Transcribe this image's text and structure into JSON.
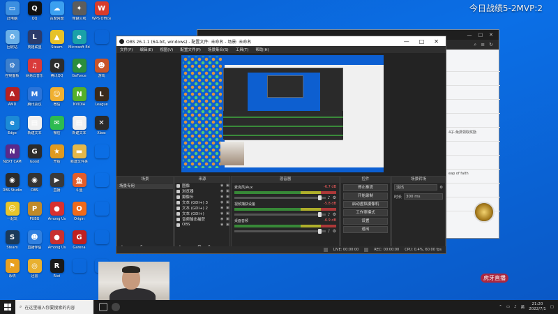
{
  "overlay": {
    "title": "今日战绩5-2MVP:2"
  },
  "desktop": {
    "icons": [
      {
        "label": "此电脑",
        "icon": "computer-icon",
        "color": "#3c8fe0",
        "glyph": "▭"
      },
      {
        "label": "QQ",
        "icon": "qq-icon",
        "color": "#111111",
        "glyph": "Q"
      },
      {
        "label": "百度网盘",
        "icon": "baidu-netdisk-icon",
        "color": "#3ca0f0",
        "glyph": "☁"
      },
      {
        "label": "穿越火线",
        "icon": "game-icon",
        "color": "#5d5d5d",
        "glyph": "✦"
      },
      {
        "label": "WPS Office",
        "icon": "wps-icon",
        "color": "#d83b2b",
        "glyph": "W"
      },
      {
        "label": "回收站",
        "icon": "recycle-bin-icon",
        "color": "#6ab0e8",
        "glyph": "♻"
      },
      {
        "label": "英雄联盟",
        "icon": "game-icon",
        "color": "#2b3b6b",
        "glyph": "L"
      },
      {
        "label": "Steam",
        "icon": "app-icon",
        "color": "#e6c229",
        "glyph": "▲"
      },
      {
        "label": "Microsoft Edge",
        "icon": "edge-icon",
        "color": "#1aa1a8",
        "glyph": "e"
      },
      {
        "label": "",
        "icon": "blank-icon",
        "color": "transparent",
        "glyph": ""
      },
      {
        "label": "控制面板",
        "icon": "control-panel-icon",
        "color": "#3d7fcc",
        "glyph": "⚙"
      },
      {
        "label": "网易云音乐",
        "icon": "music-icon",
        "color": "#d93a3a",
        "glyph": "♫"
      },
      {
        "label": "腾讯QQ",
        "icon": "qq-icon",
        "color": "#2d2d2d",
        "glyph": "Q"
      },
      {
        "label": "GeForce",
        "icon": "geforce-icon",
        "color": "#2c8e3c",
        "glyph": "◆"
      },
      {
        "label": "游戏",
        "icon": "game-icon",
        "color": "#c8542a",
        "glyph": "☻"
      },
      {
        "label": "AMD",
        "icon": "amd-icon",
        "color": "#b62121",
        "glyph": "A"
      },
      {
        "label": "腾讯会议",
        "icon": "meeting-icon",
        "color": "#2b74d9",
        "glyph": "M"
      },
      {
        "label": "微信",
        "icon": "app-icon",
        "color": "#f0b030",
        "glyph": "☺"
      },
      {
        "label": "NVIDIA",
        "icon": "nvidia-icon",
        "color": "#55b02a",
        "glyph": "N"
      },
      {
        "label": "League",
        "icon": "game-icon",
        "color": "#3a2a1a",
        "glyph": "L"
      },
      {
        "label": "Edge",
        "icon": "edge-icon",
        "color": "#1c8ad6",
        "glyph": "e"
      },
      {
        "label": "新建文本",
        "icon": "file-icon",
        "color": "#f0f0f0",
        "glyph": "▤"
      },
      {
        "label": "微信",
        "icon": "wechat-icon",
        "color": "#2dbb50",
        "glyph": "✉"
      },
      {
        "label": "新建文本",
        "icon": "file-icon",
        "color": "#f0f0f0",
        "glyph": "▤"
      },
      {
        "label": "Xbox",
        "icon": "xbox-icon",
        "color": "#2a2a2a",
        "glyph": "✕"
      },
      {
        "label": "NZXT CAM",
        "icon": "nzxt-icon",
        "color": "#5a2a8a",
        "glyph": "N"
      },
      {
        "label": "Good",
        "icon": "app-icon",
        "color": "#2b2b2b",
        "glyph": "G"
      },
      {
        "label": "开始",
        "icon": "app-icon",
        "color": "#e09a20",
        "glyph": "★"
      },
      {
        "label": "新建文件夹",
        "icon": "folder-icon",
        "color": "#e5b84a",
        "glyph": "▬"
      },
      {
        "label": "",
        "icon": "blank-icon",
        "color": "transparent",
        "glyph": ""
      },
      {
        "label": "OBS Studio",
        "icon": "obs-icon",
        "color": "#2b2b2b",
        "glyph": "◉"
      },
      {
        "label": "OBS",
        "icon": "obs-icon",
        "color": "#333333",
        "glyph": "◉"
      },
      {
        "label": "直播",
        "icon": "app-icon",
        "color": "#3a3a3a",
        "glyph": "▶"
      },
      {
        "label": "斗鱼",
        "icon": "app-icon",
        "color": "#e35d2a",
        "glyph": "鱼"
      },
      {
        "label": "",
        "icon": "blank-icon",
        "color": "transparent",
        "glyph": ""
      },
      {
        "label": "一起玩",
        "icon": "app-icon",
        "color": "#e8c52a",
        "glyph": "☺"
      },
      {
        "label": "PUBG",
        "icon": "pubg-icon",
        "color": "#c08a2a",
        "glyph": "P"
      },
      {
        "label": "Among Us",
        "icon": "app-icon",
        "color": "#d83030",
        "glyph": "●"
      },
      {
        "label": "Origin",
        "icon": "origin-icon",
        "color": "#f06a1a",
        "glyph": "O"
      },
      {
        "label": "",
        "icon": "blank-icon",
        "color": "transparent",
        "glyph": ""
      },
      {
        "label": "Steam",
        "icon": "steam-icon",
        "color": "#1b3a5a",
        "glyph": "S"
      },
      {
        "label": "直播伴侣",
        "icon": "app-icon",
        "color": "#3080e0",
        "glyph": "☻"
      },
      {
        "label": "Among Us",
        "icon": "app-icon",
        "color": "#c83030",
        "glyph": "●"
      },
      {
        "label": "Garena",
        "icon": "app-icon",
        "color": "#c02020",
        "glyph": "G"
      },
      {
        "label": "",
        "icon": "blank-icon",
        "color": "transparent",
        "glyph": ""
      },
      {
        "label": "系统",
        "icon": "app-icon",
        "color": "#e8a020",
        "glyph": "⚑"
      },
      {
        "label": "迅雷",
        "icon": "app-icon",
        "color": "#e8b030",
        "glyph": "◎"
      },
      {
        "label": "Riot",
        "icon": "riot-icon",
        "color": "#1a1a1a",
        "glyph": "R"
      },
      {
        "label": "",
        "icon": "blank-icon",
        "color": "transparent",
        "glyph": ""
      },
      {
        "label": "",
        "icon": "blank-icon",
        "color": "transparent",
        "glyph": ""
      }
    ]
  },
  "side_window": {
    "controls": [
      "—",
      "□",
      "✕"
    ],
    "items": [
      {
        "title": "",
        "sub": ""
      },
      {
        "title": "",
        "sub": ""
      },
      {
        "title": "",
        "sub": ""
      },
      {
        "title": "",
        "sub": ""
      },
      {
        "title": "",
        "sub": ""
      },
      {
        "title": "4子-免费领取奖励",
        "sub": ""
      },
      {
        "title": "",
        "sub": ""
      },
      {
        "title": "",
        "sub": ""
      },
      {
        "title": "eap of faith",
        "sub": ""
      },
      {
        "title": "",
        "sub": ""
      },
      {
        "title": "",
        "sub": ""
      }
    ]
  },
  "obs": {
    "title": "OBS 26.1.1 (64-bit, windows) - 配置文件: 未命名 - 场景: 未命名",
    "window_controls": [
      "—",
      "□",
      "✕"
    ],
    "menu": [
      "文件(F)",
      "编辑(E)",
      "视图(V)",
      "配置文件(P)",
      "场景集合(S)",
      "工具(T)",
      "帮助(H)"
    ],
    "scenes": {
      "header": "场景",
      "items": [
        "场景专用"
      ]
    },
    "sources": {
      "header": "来源",
      "items": [
        "图像",
        "浏览器",
        "摄像头",
        "文本 (GDI+) 3",
        "文本 (GDI+) 2",
        "文本 (GDI+)",
        "音频输出捕获",
        "OBS"
      ]
    },
    "mixer": {
      "header": "混音器",
      "channels": [
        {
          "name": "麦克风/Aux",
          "db": "-6.7 dB"
        },
        {
          "name": "视频捕获设备",
          "db": "-5.8 dB"
        },
        {
          "name": "桌面音频",
          "db": "-6.9 dB"
        }
      ]
    },
    "controls": {
      "header": "控件",
      "buttons": [
        "停止推流",
        "开始录制",
        "启动虚拟摄像机",
        "工作室模式",
        "设置",
        "退出"
      ]
    },
    "transitions": {
      "header": "场景转场",
      "type": "淡出",
      "duration_label": "时长",
      "duration": "300 ms"
    },
    "status": {
      "live": "LIVE: 00:00:00",
      "rec": "REC: 00:00:00",
      "cpu": "CPU: 0.4%, 60.00 fps"
    }
  },
  "taskbar": {
    "search_placeholder": "在这里输入你要搜索的内容",
    "time": "21:20",
    "date": "2022/7/1",
    "tray_lang": "英"
  },
  "watermark": "虎牙直播"
}
